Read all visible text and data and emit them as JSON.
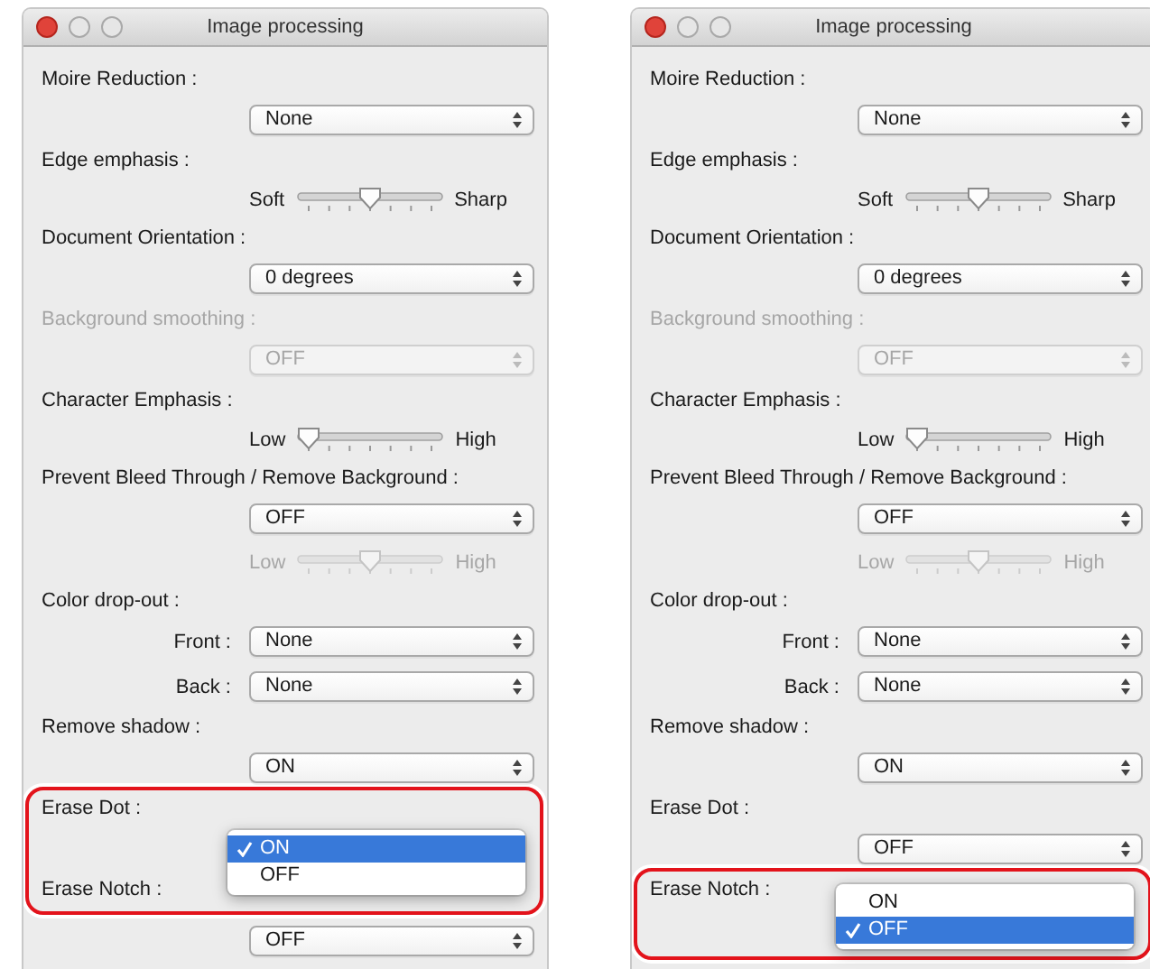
{
  "windows": [
    {
      "title": "Image processing",
      "items": [
        {
          "kind": "label",
          "text": "Moire Reduction :",
          "disabled": false
        },
        {
          "kind": "select",
          "value": "None",
          "disabled": false
        },
        {
          "kind": "label",
          "text": "Edge emphasis :",
          "disabled": false
        },
        {
          "kind": "slider",
          "min_label": "Soft",
          "max_label": "Sharp",
          "level": 0.5,
          "disabled": false
        },
        {
          "kind": "label",
          "text": "Document Orientation :",
          "disabled": false
        },
        {
          "kind": "select",
          "value": "0 degrees",
          "disabled": false
        },
        {
          "kind": "label",
          "text": "Background smoothing :",
          "disabled": true
        },
        {
          "kind": "select",
          "value": "OFF",
          "disabled": true
        },
        {
          "kind": "label",
          "text": "Character Emphasis :",
          "disabled": false
        },
        {
          "kind": "slider",
          "min_label": "Low",
          "max_label": "High",
          "level": 0,
          "disabled": false
        },
        {
          "kind": "label",
          "text": "Prevent Bleed Through / Remove Background :",
          "disabled": false
        },
        {
          "kind": "select",
          "value": "OFF",
          "disabled": false
        },
        {
          "kind": "slider",
          "min_label": "Low",
          "max_label": "High",
          "level": 0.5,
          "disabled": true
        },
        {
          "kind": "label",
          "text": "Color drop-out :",
          "disabled": false
        },
        {
          "kind": "select",
          "label": "Front :",
          "value": "None",
          "disabled": false
        },
        {
          "kind": "select",
          "label": "Back :",
          "value": "None",
          "disabled": false
        },
        {
          "kind": "label",
          "text": "Remove shadow :",
          "disabled": false
        },
        {
          "kind": "select",
          "value": "ON",
          "disabled": false
        },
        {
          "kind": "highlight",
          "items": [
            {
              "kind": "label",
              "text": "Erase Dot :",
              "disabled": false
            },
            {
              "kind": "menu",
              "options": [
                {
                  "label": "ON",
                  "selected": true
                },
                {
                  "label": "OFF",
                  "selected": false
                }
              ],
              "disabled": false
            },
            {
              "kind": "label",
              "text": "Erase Notch :",
              "disabled": false
            }
          ]
        },
        {
          "kind": "select",
          "value": "OFF",
          "disabled": false
        }
      ]
    },
    {
      "title": "Image processing",
      "items": [
        {
          "kind": "label",
          "text": "Moire Reduction :",
          "disabled": false
        },
        {
          "kind": "select",
          "value": "None",
          "disabled": false
        },
        {
          "kind": "label",
          "text": "Edge emphasis :",
          "disabled": false
        },
        {
          "kind": "slider",
          "min_label": "Soft",
          "max_label": "Sharp",
          "level": 0.5,
          "disabled": false
        },
        {
          "kind": "label",
          "text": "Document Orientation :",
          "disabled": false
        },
        {
          "kind": "select",
          "value": "0 degrees",
          "disabled": false
        },
        {
          "kind": "label",
          "text": "Background smoothing :",
          "disabled": true
        },
        {
          "kind": "select",
          "value": "OFF",
          "disabled": true
        },
        {
          "kind": "label",
          "text": "Character Emphasis :",
          "disabled": false
        },
        {
          "kind": "slider",
          "min_label": "Low",
          "max_label": "High",
          "level": 0,
          "disabled": false
        },
        {
          "kind": "label",
          "text": "Prevent Bleed Through / Remove Background :",
          "disabled": false
        },
        {
          "kind": "select",
          "value": "OFF",
          "disabled": false
        },
        {
          "kind": "slider",
          "min_label": "Low",
          "max_label": "High",
          "level": 0.5,
          "disabled": true
        },
        {
          "kind": "label",
          "text": "Color drop-out :",
          "disabled": false
        },
        {
          "kind": "select",
          "label": "Front :",
          "value": "None",
          "disabled": false
        },
        {
          "kind": "select",
          "label": "Back :",
          "value": "None",
          "disabled": false
        },
        {
          "kind": "label",
          "text": "Remove shadow :",
          "disabled": false
        },
        {
          "kind": "select",
          "value": "ON",
          "disabled": false
        },
        {
          "kind": "label",
          "text": "Erase Dot :",
          "disabled": false
        },
        {
          "kind": "select",
          "value": "OFF",
          "disabled": false
        },
        {
          "kind": "highlight",
          "items": [
            {
              "kind": "label",
              "text": "Erase Notch :",
              "disabled": false
            },
            {
              "kind": "menu",
              "options": [
                {
                  "label": "ON",
                  "selected": false
                },
                {
                  "label": "OFF",
                  "selected": true
                }
              ],
              "disabled": false
            }
          ]
        }
      ]
    }
  ]
}
